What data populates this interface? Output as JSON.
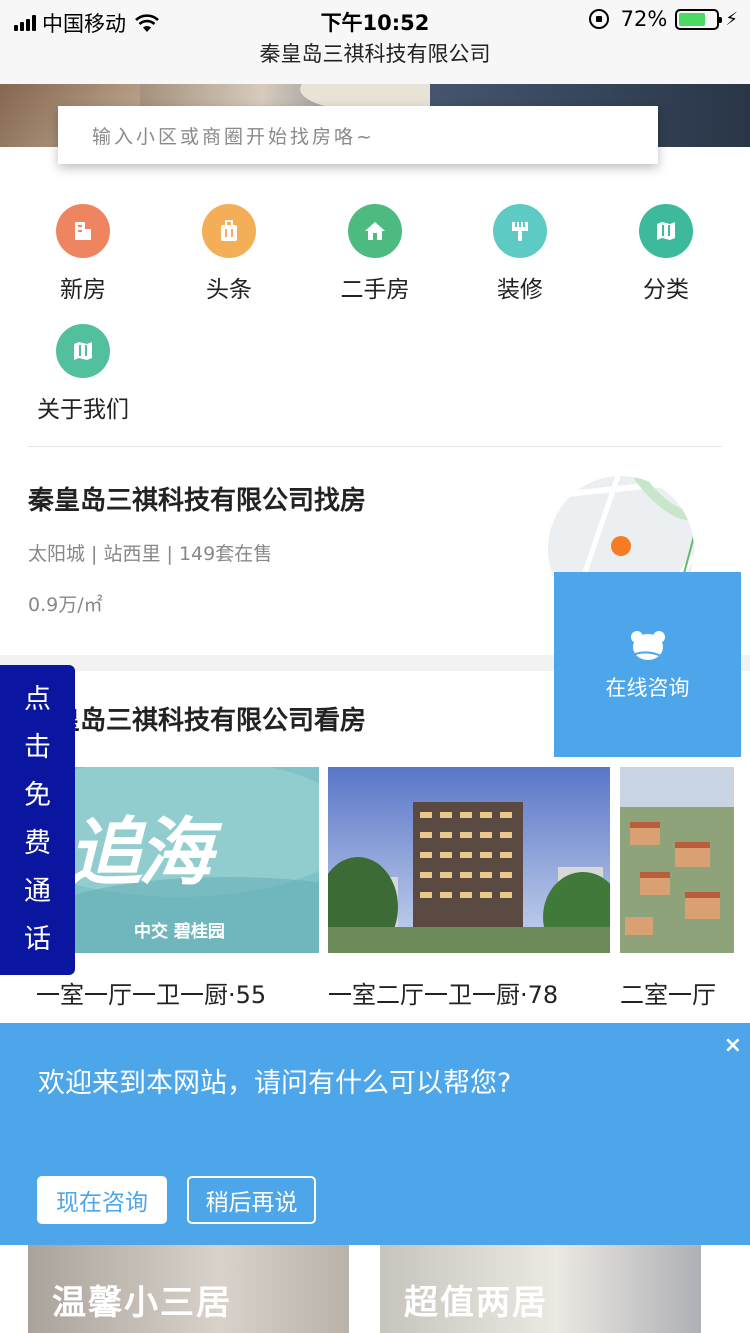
{
  "status_bar": {
    "carrier": "中国移动",
    "time": "下午10:52",
    "battery": "72%",
    "battery_fraction": 0.72
  },
  "header": {
    "site_title": "秦皇岛三祺科技有限公司"
  },
  "search": {
    "placeholder": "输入小区或商圈开始找房咯~"
  },
  "nav": [
    {
      "label": "新房",
      "icon": "building-icon",
      "color": "#ee8460"
    },
    {
      "label": "头条",
      "icon": "suitcase-icon",
      "color": "#f3ae57"
    },
    {
      "label": "二手房",
      "icon": "home-icon",
      "color": "#4dbb7f"
    },
    {
      "label": "装修",
      "icon": "paint-brush-icon",
      "color": "#5dcbc4"
    },
    {
      "label": "分类",
      "icon": "map-icon",
      "color": "#3dba9c"
    },
    {
      "label": "关于我们",
      "icon": "map-icon",
      "color": "#52c09d"
    }
  ],
  "find_house": {
    "title": "秦皇岛三祺科技有限公司找房",
    "meta": "太阳城 | 站西里 | 149套在售",
    "price": "0.9万/㎡"
  },
  "see_house": {
    "title": "秦皇岛三祺科技有限公司看房",
    "cards": [
      {
        "image_text": "追海",
        "brand": "中交 碧桂园",
        "caption": "一室一厅一卫一厨·55"
      },
      {
        "caption": "一室二厅一卫一厨·78"
      },
      {
        "caption": "二室一厅"
      }
    ]
  },
  "online_consult": {
    "label": "在线咨询"
  },
  "free_call": {
    "chars": [
      "点",
      "击",
      "免",
      "费",
      "通",
      "话"
    ]
  },
  "welcome": {
    "message": "欢迎来到本网站，请问有什么可以帮您?",
    "close": "×",
    "consult_now": "现在咨询",
    "later": "稍后再说"
  },
  "promos": [
    {
      "title": "温馨小三居"
    },
    {
      "title": "超值两居"
    }
  ]
}
